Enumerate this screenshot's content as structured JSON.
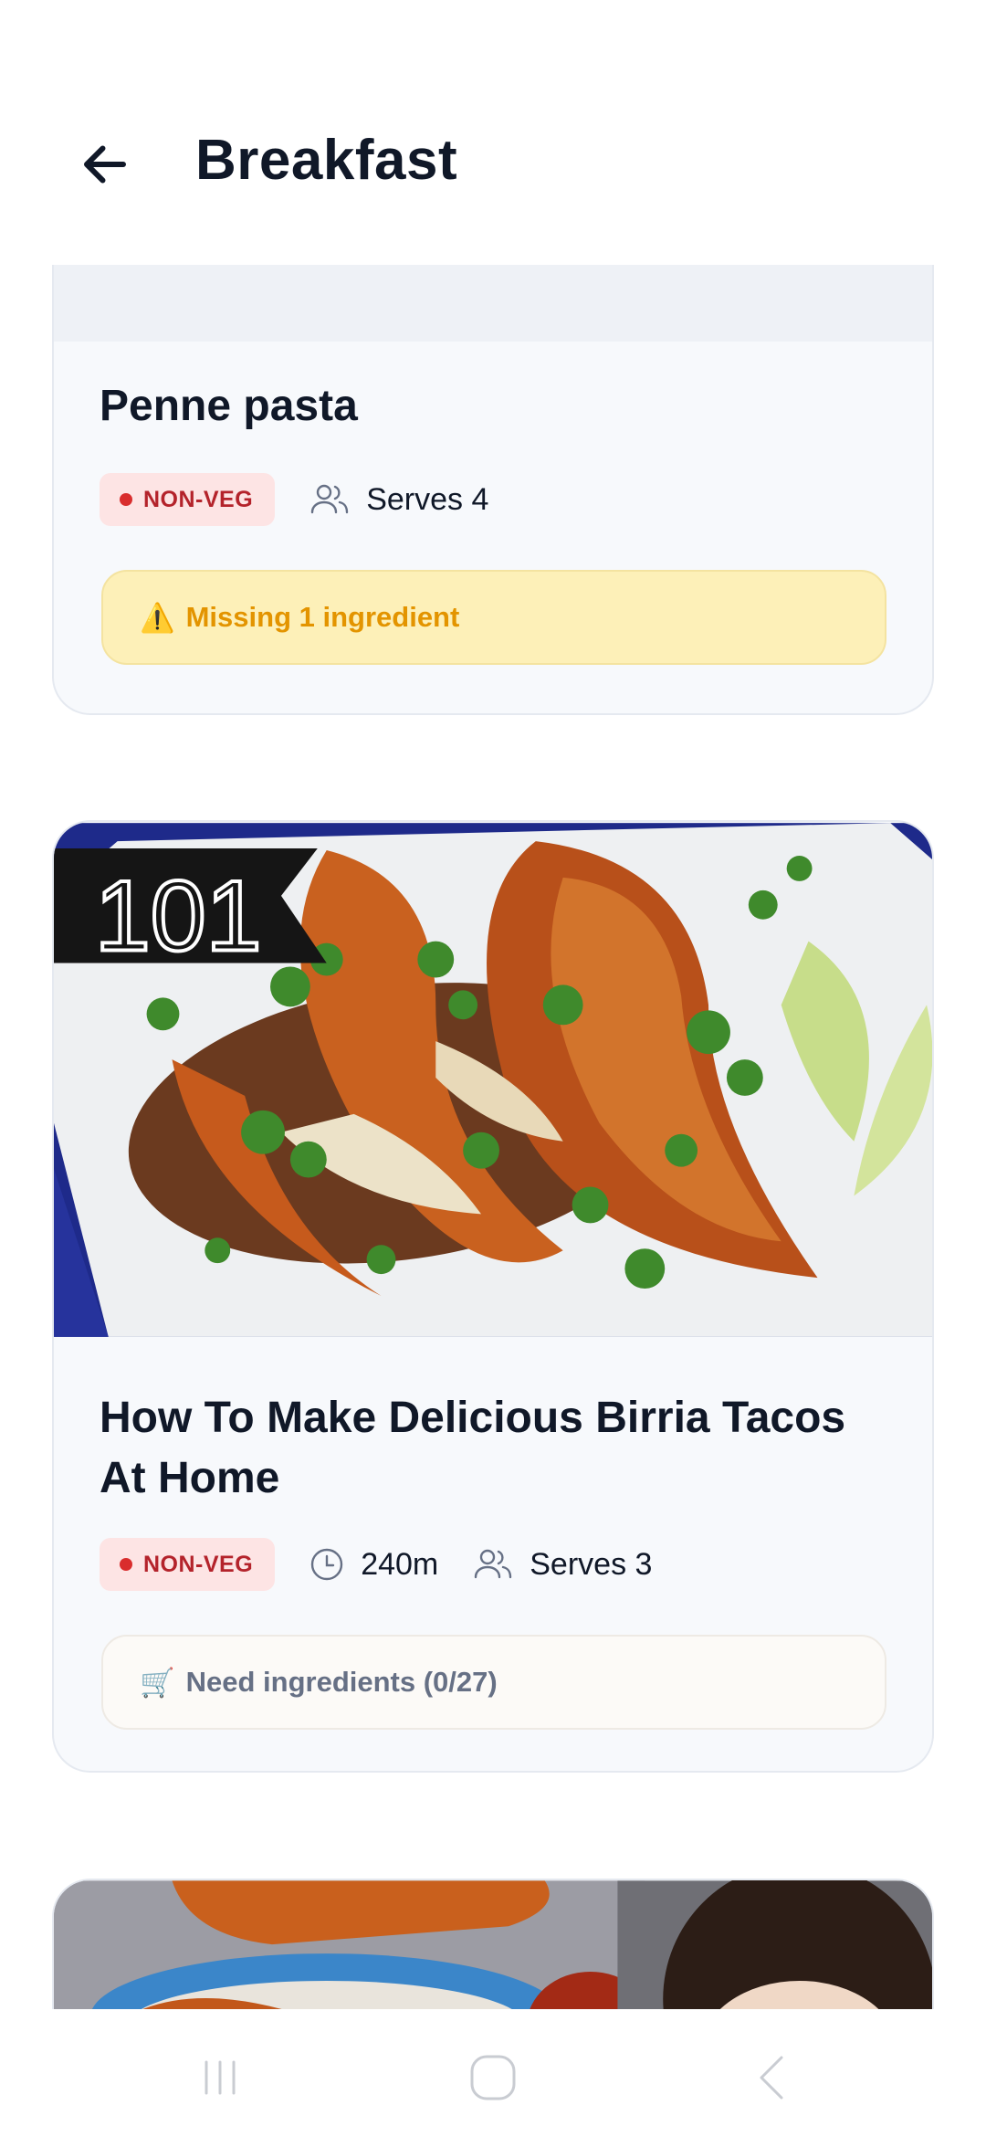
{
  "header": {
    "title": "Breakfast",
    "back_icon": "arrow-left-icon"
  },
  "recipes": [
    {
      "title": "Penne pasta",
      "diet_badge": "NON-VEG",
      "serves": "Serves 4",
      "alert_icon": "⚠️",
      "alert_text": "Missing 1 ingredient"
    },
    {
      "title": "How To Make Delicious Birria Tacos At Home",
      "thumbnail_badge": "101",
      "diet_badge": "NON-VEG",
      "time": "240m",
      "serves": "Serves 3",
      "alert_icon": "🛒",
      "alert_text": "Need ingredients (0/27)"
    },
    {
      "title": ""
    }
  ],
  "system_nav": {
    "recents_icon": "recents-icon",
    "home_icon": "home-icon",
    "back_icon": "system-back-icon"
  },
  "colors": {
    "nonveg_badge_bg": "#fde4e4",
    "nonveg_badge_text": "#b4232b",
    "missing_alert_bg": "#fdf0b8",
    "missing_alert_text": "#e39400",
    "card_bg": "#f7f9fc"
  }
}
